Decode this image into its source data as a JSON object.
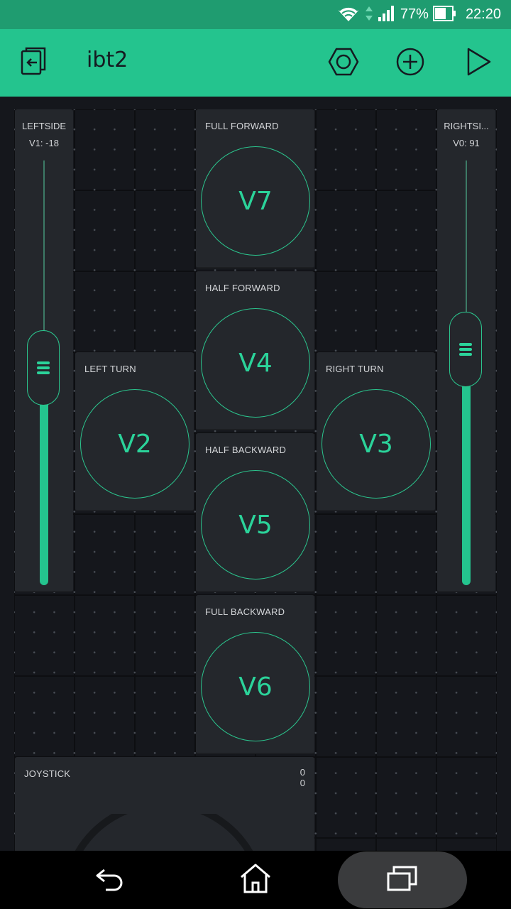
{
  "status_bar": {
    "battery": "77%",
    "time": "22:20"
  },
  "app_bar": {
    "title": "ibt2"
  },
  "widgets": {
    "leftside": {
      "label": "LEFTSIDE",
      "value": "V1: -18"
    },
    "rightside": {
      "label": "RIGHTSI...",
      "value": "V0: 91"
    },
    "full_forward": {
      "label": "FULL FORWARD",
      "pin": "V7"
    },
    "half_forward": {
      "label": "HALF FORWARD",
      "pin": "V4"
    },
    "left_turn": {
      "label": "LEFT TURN",
      "pin": "V2"
    },
    "right_turn": {
      "label": "RIGHT TURN",
      "pin": "V3"
    },
    "half_backward": {
      "label": "HALF BACKWARD",
      "pin": "V5"
    },
    "full_backward": {
      "label": "FULL BACKWARD",
      "pin": "V6"
    },
    "joystick": {
      "label": "JOYSTICK",
      "x": "0",
      "y": "0"
    }
  },
  "colors": {
    "accent": "#24c48e",
    "status_bar": "#1f9c70",
    "widget_bg": "#24272c",
    "canvas_bg": "#15171c"
  },
  "icons": {
    "back_to_projects": "exit-icon",
    "settings": "hexagon-settings-icon",
    "add_widget": "plus-circle-icon",
    "run": "play-icon",
    "nav_back": "back-arrow-icon",
    "nav_home": "home-icon",
    "nav_recents": "recents-icon"
  }
}
